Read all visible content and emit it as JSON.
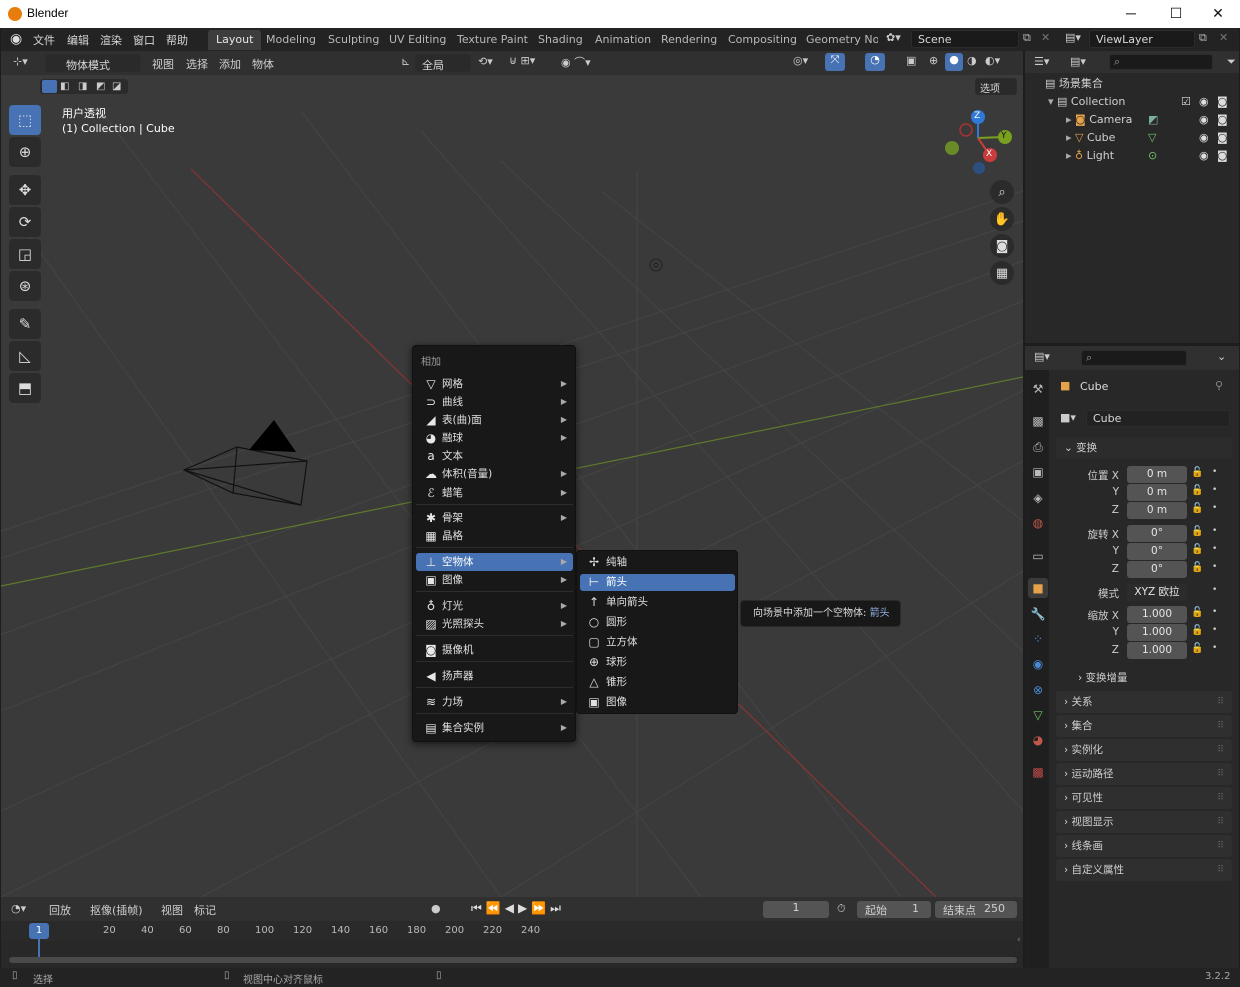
{
  "window": {
    "title": "Blender",
    "min": "─",
    "max": "☐",
    "close": "✕"
  },
  "menubar": {
    "items": [
      "文件",
      "编辑",
      "渲染",
      "窗口",
      "帮助"
    ]
  },
  "workspaces": [
    "Layout",
    "Modeling",
    "Sculpting",
    "UV Editing",
    "Texture Paint",
    "Shading",
    "Animation",
    "Rendering",
    "Compositing",
    "Geometry Noc"
  ],
  "scene": "Scene",
  "view_layer": "ViewLayer",
  "viewport_header": {
    "mode": "物体模式",
    "menus": [
      "视图",
      "选择",
      "添加",
      "物体"
    ],
    "orientation": "全局",
    "options": "选项"
  },
  "viewport_overlay": {
    "view_name": "用户透视",
    "context": "(1) Collection | Cube"
  },
  "gizmo": {
    "x": "X",
    "y": "Y",
    "z": "Z"
  },
  "add_menu": {
    "title": "相加",
    "items": [
      {
        "label": "网格",
        "icon": "mesh-icon",
        "glyph": "▽",
        "submenu": true
      },
      {
        "label": "曲线",
        "icon": "curve-icon",
        "glyph": "⊃",
        "submenu": true
      },
      {
        "label": "表(曲)面",
        "icon": "surface-icon",
        "glyph": "◢",
        "submenu": true
      },
      {
        "label": "融球",
        "icon": "metaball-icon",
        "glyph": "◕",
        "submenu": true
      },
      {
        "label": "文本",
        "icon": "text-icon",
        "glyph": "a",
        "submenu": false
      },
      {
        "label": "体积(音量)",
        "icon": "volume-icon",
        "glyph": "☁",
        "submenu": true
      },
      {
        "label": "蜡笔",
        "icon": "grease-pencil-icon",
        "glyph": "ℰ",
        "submenu": true
      },
      {
        "label": "骨架",
        "icon": "armature-icon",
        "glyph": "✱",
        "submenu": true
      },
      {
        "label": "晶格",
        "icon": "lattice-icon",
        "glyph": "▦",
        "submenu": false
      },
      {
        "label": "空物体",
        "icon": "empty-icon",
        "glyph": "⊥",
        "submenu": true
      },
      {
        "label": "图像",
        "icon": "image-icon",
        "glyph": "▣",
        "submenu": true
      },
      {
        "label": "灯光",
        "icon": "light-icon",
        "glyph": "♁",
        "submenu": true
      },
      {
        "label": "光照探头",
        "icon": "light-probe-icon",
        "glyph": "▨",
        "submenu": true
      },
      {
        "label": "摄像机",
        "icon": "camera-icon",
        "glyph": "◙",
        "submenu": false
      },
      {
        "label": "扬声器",
        "icon": "speaker-icon",
        "glyph": "◀",
        "submenu": false
      },
      {
        "label": "力场",
        "icon": "force-field-icon",
        "glyph": "≋",
        "submenu": true
      },
      {
        "label": "集合实例",
        "icon": "collection-instance-icon",
        "glyph": "▤",
        "submenu": true
      }
    ]
  },
  "empty_submenu": {
    "items": [
      {
        "label": "纯轴",
        "icon": "plain-axes-icon",
        "glyph": "✢"
      },
      {
        "label": "箭头",
        "icon": "arrows-icon",
        "glyph": "⊢"
      },
      {
        "label": "单向箭头",
        "icon": "single-arrow-icon",
        "glyph": "↑"
      },
      {
        "label": "圆形",
        "icon": "circle-icon",
        "glyph": "○"
      },
      {
        "label": "立方体",
        "icon": "cube-icon",
        "glyph": "▢"
      },
      {
        "label": "球形",
        "icon": "sphere-icon",
        "glyph": "⊕"
      },
      {
        "label": "锥形",
        "icon": "cone-icon",
        "glyph": "△"
      },
      {
        "label": "图像",
        "icon": "image-icon",
        "glyph": "▣"
      }
    ]
  },
  "tooltip": {
    "text": "向场景中添加一个空物体: ",
    "highlight": "箭头"
  },
  "outliner": {
    "root": "场景集合",
    "collection": "Collection",
    "objects": [
      {
        "name": "Camera",
        "icon": "camera-object-icon",
        "color": "#e5a24b"
      },
      {
        "name": "Cube",
        "icon": "mesh-object-icon",
        "color": "#e5a24b"
      },
      {
        "name": "Light",
        "icon": "light-object-icon",
        "color": "#e5a24b"
      }
    ]
  },
  "properties": {
    "object_name": "Cube",
    "datablock": "Cube",
    "transform_title": "变换",
    "location": {
      "label": "位置",
      "x": "0 m",
      "y": "0 m",
      "z": "0 m"
    },
    "rotation": {
      "label": "旋转",
      "x": "0°",
      "y": "0°",
      "z": "0°"
    },
    "mode_label": "模式",
    "mode_value": "XYZ 欧拉",
    "scale": {
      "label": "缩放",
      "x": "1.000",
      "y": "1.000",
      "z": "1.000"
    },
    "axis_labels": [
      "X",
      "Y",
      "Z"
    ],
    "delta": "变换增量",
    "sections": [
      "关系",
      "集合",
      "实例化",
      "运动路径",
      "可见性",
      "视图显示",
      "线条画",
      "自定义属性"
    ]
  },
  "timeline": {
    "menus": [
      "回放",
      "抠像(插帧)",
      "视图",
      "标记"
    ],
    "current_frame": "1",
    "start_label": "起始",
    "start": "1",
    "end_label": "结束点",
    "end": "250",
    "ticks": [
      "20",
      "40",
      "60",
      "80",
      "100",
      "120",
      "140",
      "160",
      "180",
      "200",
      "220",
      "240"
    ],
    "playhead": "1"
  },
  "statusbar": {
    "left": "选择",
    "middle": "视图中心对齐鼠标",
    "version": "3.2.2"
  },
  "colors": {
    "accent": "#4772b3",
    "x_axis": "#c83c3c",
    "y_axis": "#7aa01f",
    "z_axis": "#2f7ad8"
  }
}
